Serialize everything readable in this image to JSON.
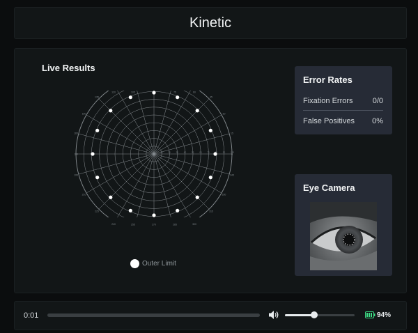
{
  "header": {
    "title": "Kinetic"
  },
  "live_results": {
    "title": "Live Results",
    "ring_labels": [
      "10",
      "20",
      "30",
      "40",
      "50",
      "60",
      "70",
      "80",
      "90",
      "100"
    ],
    "angle_labels": [
      "0",
      "15",
      "30",
      "45",
      "60",
      "75",
      "90",
      "105",
      "120",
      "135",
      "150",
      "165",
      "180",
      "195",
      "210",
      "225",
      "240",
      "255",
      "270",
      "285",
      "300",
      "315",
      "330",
      "345"
    ],
    "legend_label": "Outer Limit",
    "point_color": "#ffffff",
    "grid_color": "#8a9094"
  },
  "error_rates": {
    "title": "Error Rates",
    "fixation_label": "Fixation Errors",
    "fixation_value": "0/0",
    "false_positive_label": "False Positives",
    "false_positive_value": "0%"
  },
  "eye_camera": {
    "title": "Eye Camera"
  },
  "player": {
    "time": "0:01",
    "progress": 0.0,
    "volume": 0.42,
    "battery": "94%",
    "volume_icon": "speaker-icon",
    "battery_icon": "battery-icon",
    "accent_color": "#3ddc84"
  }
}
